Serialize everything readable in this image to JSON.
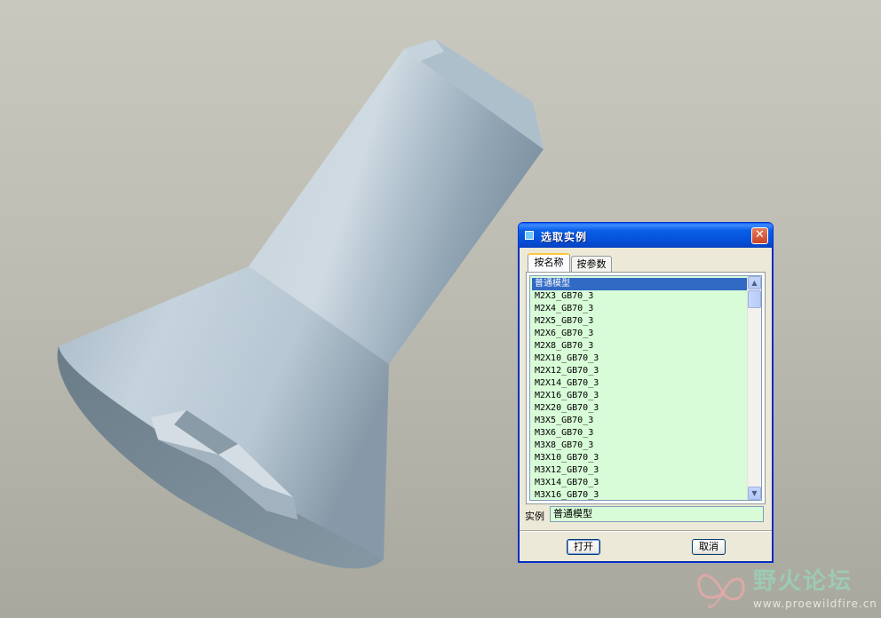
{
  "dialog": {
    "title": "选取实例",
    "close_symbol": "✕",
    "tabs": [
      {
        "label": "按名称",
        "active": true
      },
      {
        "label": "按参数",
        "active": false
      }
    ],
    "list": {
      "items": [
        "普通模型",
        "M2X3_GB70_3",
        "M2X4_GB70_3",
        "M2X5_GB70_3",
        "M2X6_GB70_3",
        "M2X8_GB70_3",
        "M2X10_GB70_3",
        "M2X12_GB70_3",
        "M2X14_GB70_3",
        "M2X16_GB70_3",
        "M2X20_GB70_3",
        "M3X5_GB70_3",
        "M3X6_GB70_3",
        "M3X8_GB70_3",
        "M3X10_GB70_3",
        "M3X12_GB70_3",
        "M3X14_GB70_3",
        "M3X16_GB70_3"
      ],
      "selected_index": 0
    },
    "instance_label": "实例",
    "instance_value": "普通模型",
    "buttons": {
      "open": "打开",
      "cancel": "取消"
    }
  },
  "watermark": {
    "text": "野火论坛",
    "url": "www.proewildfire.cn"
  },
  "colors": {
    "list_background": "#d8fbd8",
    "selection": "#316ac5",
    "titlebar": "#0a5fe8",
    "model_surface": "#b8c8d4"
  }
}
